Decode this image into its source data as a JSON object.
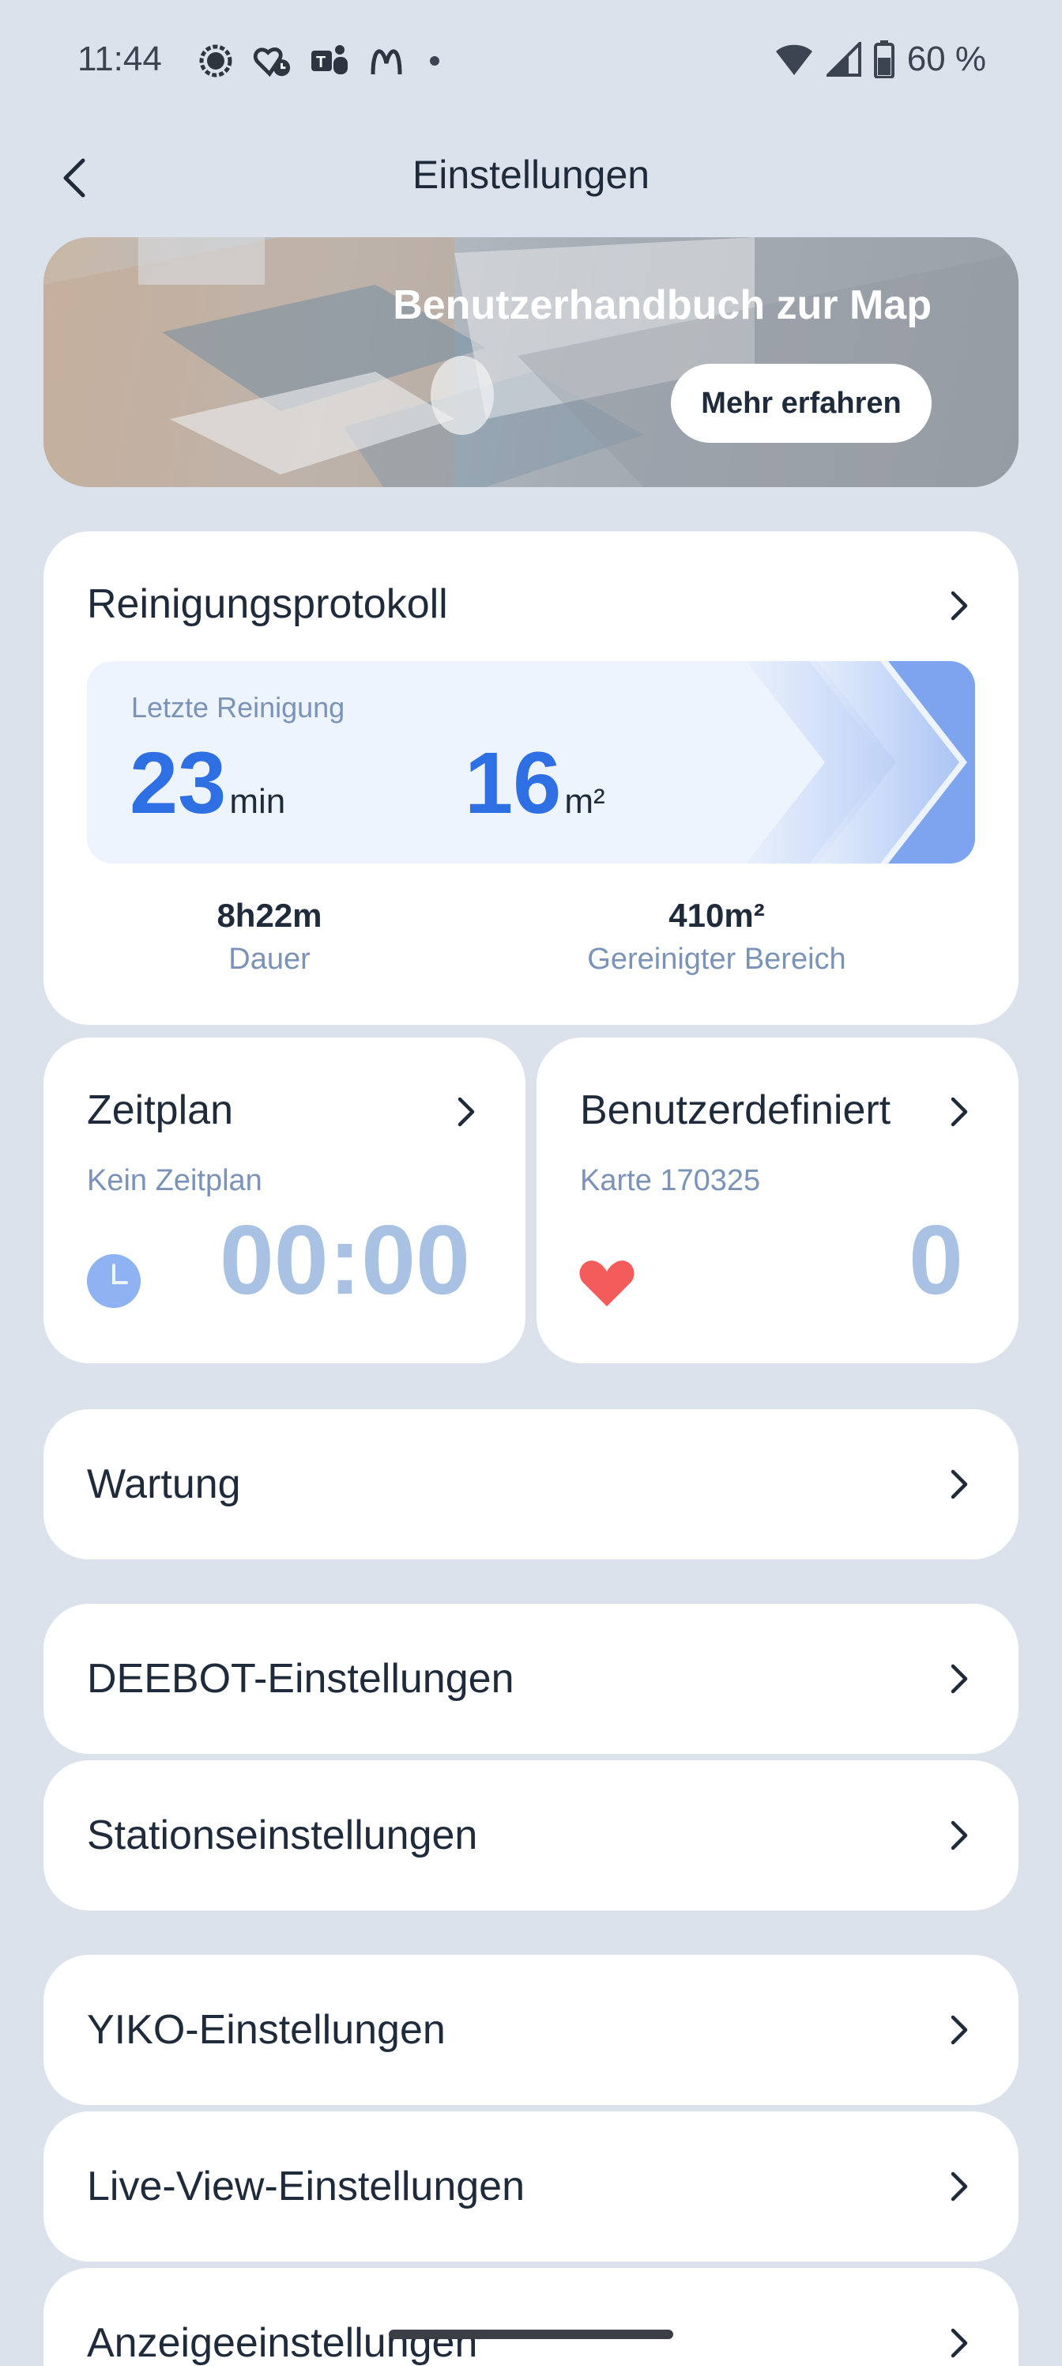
{
  "status_bar": {
    "time": "11:44",
    "notification_icons": [
      "signal-messenger-icon",
      "heart-clock-icon",
      "teams-icon",
      "mcdonalds-icon"
    ],
    "battery": "60 %"
  },
  "header": {
    "title": "Einstellungen"
  },
  "banner": {
    "title": "Benutzerhandbuch zur Map",
    "button": "Mehr erfahren"
  },
  "cleaning_log": {
    "title": "Reinigungsprotokoll",
    "last_label": "Letzte Reinigung",
    "last_duration": "23",
    "last_duration_unit": "min",
    "last_area": "16",
    "last_area_unit": "m²",
    "total_duration": "8h22m",
    "total_duration_label": "Dauer",
    "total_area": "410m²",
    "total_area_label": "Gereinigter Bereich"
  },
  "schedule": {
    "title": "Zeitplan",
    "subtitle": "Kein Zeitplan",
    "time": "00:00"
  },
  "custom": {
    "title": "Benutzerdefiniert",
    "subtitle": "Karte 170325",
    "count": "0"
  },
  "rows": {
    "maintenance": "Wartung",
    "deebot": "DEEBOT-Einstellungen",
    "station": "Stationseinstellungen",
    "yiko": "YIKO-Einstellungen",
    "liveview": "Live-View-Einstellungen",
    "display": "Anzeigeeinstellungen"
  },
  "colors": {
    "accent_blue": "#2f6fe4",
    "muted_blue": "#a9c1e3",
    "heart_red": "#f45b5b",
    "background": "#dbe2ec"
  }
}
